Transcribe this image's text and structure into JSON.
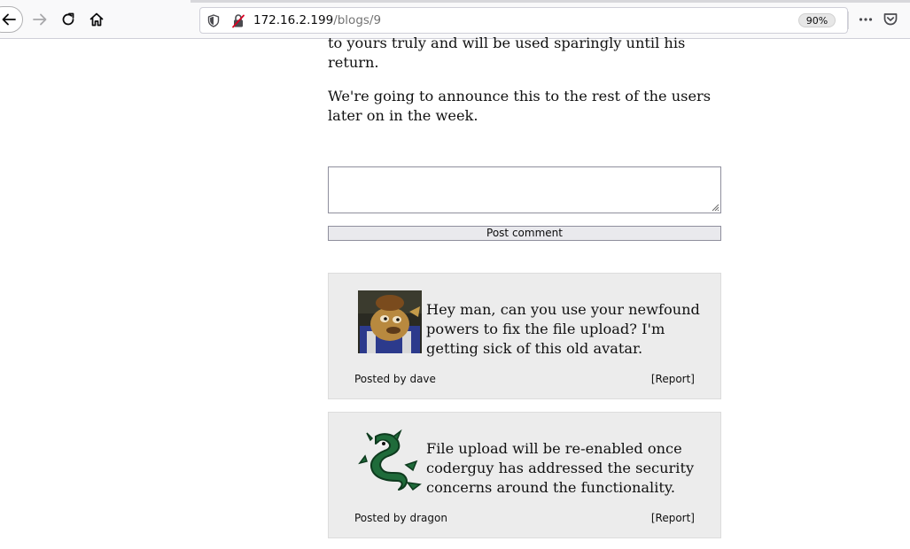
{
  "browser": {
    "url_host": "172.16.2.199",
    "url_path": "/blogs/9",
    "zoom": "90%"
  },
  "post": {
    "paragraphs": [
      "to yours truly and will be used sparingly until his return.",
      "We're going to announce this to the rest of the users later on in the week."
    ]
  },
  "comment_form": {
    "textarea_value": "",
    "submit_label": "Post comment"
  },
  "comments": [
    {
      "text": "Hey man, can you use your newfound powers to fix the file upload? I'm getting sick of this old avatar.",
      "author_line": "Posted by dave",
      "report_label": "[Report]"
    },
    {
      "text": "File upload will be re-enabled once coderguy has addressed the security concerns around the functionality.",
      "author_line": "Posted by dragon",
      "report_label": "[Report]"
    }
  ],
  "icons": {
    "back": "arrow-left-icon",
    "forward": "arrow-right-icon",
    "reload": "reload-icon",
    "home": "home-icon",
    "tracking": "shield-icon",
    "insecure": "insecure-lock-icon",
    "menu": "more-dots-icon",
    "pocket": "pocket-icon"
  },
  "colors": {
    "toolbar_bg": "#f9f9fa",
    "comment_bg": "#ececec",
    "insecure_red": "#d70022"
  }
}
